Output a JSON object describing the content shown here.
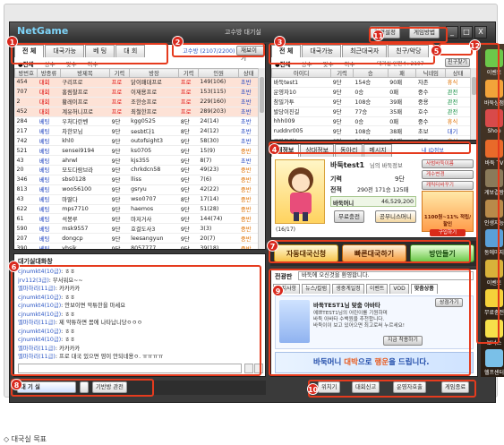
{
  "window": {
    "title": "고수방 대기실",
    "logo": "NetGame",
    "buttons": {
      "env": "환경설정",
      "guide": "게임방법",
      "min": "_",
      "max": "□",
      "close": "X"
    }
  },
  "room_list": {
    "tabs": [
      "전 체",
      "대국가능",
      "베 팅",
      "대 회"
    ],
    "active_tab": "전 체",
    "count_label": "고수방 (2107/2200)",
    "quick_button": "재보이기",
    "subtabs": [
      "●전체",
      "상수",
      "맞수",
      "하수"
    ],
    "headers": [
      "방번호",
      "방종류",
      "방제목",
      "기력",
      "방장",
      "기력",
      "인원",
      "상태"
    ],
    "rows": [
      [
        "454",
        "대회",
        "구리프로",
        "프로",
        "닭이패대프로",
        "프로",
        "149(106)",
        "초반",
        "BC"
      ],
      [
        "707",
        "대회",
        "홍림찰프로",
        "프로",
        "이재용프로",
        "프로",
        "153(115)",
        "초반",
        "BC"
      ],
      [
        "2",
        "대회",
        "황레이프로",
        "프로",
        "조한승프로",
        "프로",
        "229(160)",
        "초반",
        "BC"
      ],
      [
        "452",
        "대회",
        "계유허니프로",
        "프로",
        "최철한프로",
        "프로",
        "289(203)",
        "초반",
        "BC"
      ],
      [
        "284",
        "베팅",
        "우처다란벤",
        "9단",
        "kgg0525",
        "8단",
        "24(14)",
        "초반",
        ""
      ],
      [
        "217",
        "베팅",
        "차한모님",
        "9단",
        "sesbt다1",
        "8단",
        "24(12)",
        "초반",
        ""
      ],
      [
        "742",
        "베팅",
        "khl0",
        "9단",
        "outofsight3",
        "9단",
        "58(30)",
        "초반",
        ""
      ],
      [
        "521",
        "베팅",
        "sensei9194",
        "9단",
        "ks0705",
        "9단",
        "15(9)",
        "중반",
        ""
      ],
      [
        "43",
        "베팅",
        "ahrwl",
        "9단",
        "kjs355",
        "9단",
        "8(7)",
        "초반",
        ""
      ],
      [
        "20",
        "베팅",
        "모도다람브라",
        "9단",
        "chrkdcn58",
        "9단",
        "49(23)",
        "중반",
        ""
      ],
      [
        "346",
        "베팅",
        "sbs0128",
        "9단",
        "lliss",
        "9단",
        "7(6)",
        "중반",
        ""
      ],
      [
        "813",
        "베팅",
        "woo56100",
        "9단",
        "gsryu",
        "9단",
        "42(22)",
        "중반",
        ""
      ],
      [
        "43",
        "베팅",
        "마딸다",
        "9단",
        "wso0707",
        "8단",
        "17(14)",
        "중반",
        ""
      ],
      [
        "622",
        "베팅",
        "mps7710",
        "9단",
        "haemos",
        "9단",
        "51(28)",
        "중반",
        ""
      ],
      [
        "61",
        "베팅",
        "석봉루",
        "9단",
        "마저거사",
        "9단",
        "144(74)",
        "중반",
        ""
      ],
      [
        "590",
        "베팅",
        "msk9557",
        "9단",
        "호걸도사3",
        "9단",
        "3(3)",
        "중반",
        ""
      ],
      [
        "207",
        "베팅",
        "dongcp",
        "9단",
        "leesangyun",
        "9단",
        "20(7)",
        "중반",
        ""
      ],
      [
        "390",
        "베팅",
        "yhsik",
        "9단",
        "8057777",
        "9단",
        "39(18)",
        "중반",
        ""
      ],
      [
        "516",
        "베팅",
        "iwgji101",
        "9단",
        "hunnngh",
        "9단",
        "13(8)",
        "중반",
        ""
      ]
    ]
  },
  "user_list": {
    "tabs": [
      "전 체",
      "대국가능",
      "최근대국자",
      "친구/악당"
    ],
    "count_label": "대기실 인원수: 2107",
    "friend_button": "친구찾기",
    "subtabs": [
      "●전체",
      "상수",
      "맞수",
      "하수"
    ],
    "headers": [
      "아이디",
      "기력",
      "승",
      "패",
      "닉네임",
      "상태"
    ],
    "rows": [
      [
        "바둑test1",
        "9단",
        "154승",
        "90패",
        "자존",
        "휴식"
      ],
      [
        "운영자10",
        "9단",
        "0승",
        "0패",
        "중수",
        "관전"
      ],
      [
        "참밀가투",
        "9단",
        "108승",
        "39패",
        "중용",
        "관전"
      ],
      [
        "발당이진길",
        "9단",
        "77승",
        "35패",
        "호수",
        "관전"
      ],
      [
        "hhh009",
        "9단",
        "0승",
        "0패",
        "중수",
        "휴식"
      ],
      [
        "ruddnr005",
        "9단",
        "108승",
        "38패",
        "초보",
        "대기"
      ],
      [
        "고파들리1",
        "9단",
        "300승",
        "73패",
        "자유",
        "휴식"
      ]
    ]
  },
  "profile": {
    "tabs": [
      "내정보",
      "상대정보",
      "동아리",
      "메시지"
    ],
    "myinfo_link": "내 ID정보",
    "name": "바둑test1",
    "name_suffix": "님의 바둑정보",
    "rank_label": "기력",
    "rank": "9단",
    "record_label": "전적",
    "record": "290전 171승 125패",
    "money_label": "바둑머니",
    "money": "46,529,200",
    "free_charge": "무료충전",
    "shop": "공부니스머니",
    "page": "(16/17)",
    "side_btns": [
      "사범바둑이름",
      "게수변경",
      "캐릭터바꾸기"
    ],
    "ad_text": "1100원~11% 적립/할인",
    "ad_button": "구입하기"
  },
  "actions": {
    "auto": "자동대국신청",
    "quick": "빠른대국하기",
    "room": "방만들기"
  },
  "chat": {
    "title": "대기실대화창",
    "lines": [
      [
        "cjnumkt4(10급)",
        ": ㅎㅎ"
      ],
      [
        "jrv112(3급)",
        ": 무서워요~~"
      ],
      [
        "엘마하리(11급)",
        ": 카카카카"
      ],
      [
        "cjnumkt4(10급)",
        ": ㅎㅎ"
      ],
      [
        "cjnumkt4(10급)",
        ": 안보이면 악튜한을 마세요"
      ],
      [
        "cjnumkt4(10급)",
        ": ㅎㅎ"
      ],
      [
        "엘마하리(11급)",
        ": 제 악튜하면 몸에 나타납니당ㅇㅇㅇ"
      ],
      [
        "cjnumkt4(10급)",
        ": ㅎㅎ"
      ],
      [
        "cjnumkt4(10급)",
        ": ㅎㅎ"
      ],
      [
        "엘마하리(11급)",
        ": 카카카카"
      ],
      [
        "엘마하리(11급)",
        ": 프로 대국 있으면 영이 안되네용ㅇ. ㅠㅠㅠㅠ"
      ]
    ]
  },
  "notice": {
    "label": "전광판",
    "text": "바둑에 오신것을 환영합니다.",
    "tabs": [
      "공지사항",
      "뉴스/칼럼",
      "생중계일정",
      "이벤트",
      "VOD",
      "맞춤상품"
    ],
    "promo_title": "바둑TEST1님 맞춤 아바타",
    "promo_more": "상점가기",
    "promo_lines": [
      "예쁘TEST1님의 어린이를 기원하며",
      "바둑 아바타 수백원을 추천합니다.",
      "바둑이이 보고 있어으면 최고로써 누르세요!"
    ],
    "promo_button": "지금 착용하기",
    "banner_pre": "바둑머니 ",
    "banner_a": "대박",
    "banner_mid": "으로 ",
    "banner_b": "행운",
    "banner_post": "을 드립니다."
  },
  "bottom": {
    "lobby": "대 기 실",
    "spectate": "기반방 관전",
    "buttons": [
      "위치기",
      "대회신고",
      "운영자호출",
      "게임종료"
    ]
  },
  "sidebar": [
    "이벤트",
    "바둑상점",
    "Shop",
    "바둑 TV",
    "게보결왕",
    "인생지능",
    "동에미지",
    "이벤트",
    "무료충전",
    "보너스",
    "헬프센터"
  ],
  "markers": [
    "1",
    "2",
    "3",
    "4",
    "5",
    "6",
    "7",
    "8",
    "9",
    "10",
    "11",
    "12"
  ],
  "footer": "◇ 대국실 목표"
}
